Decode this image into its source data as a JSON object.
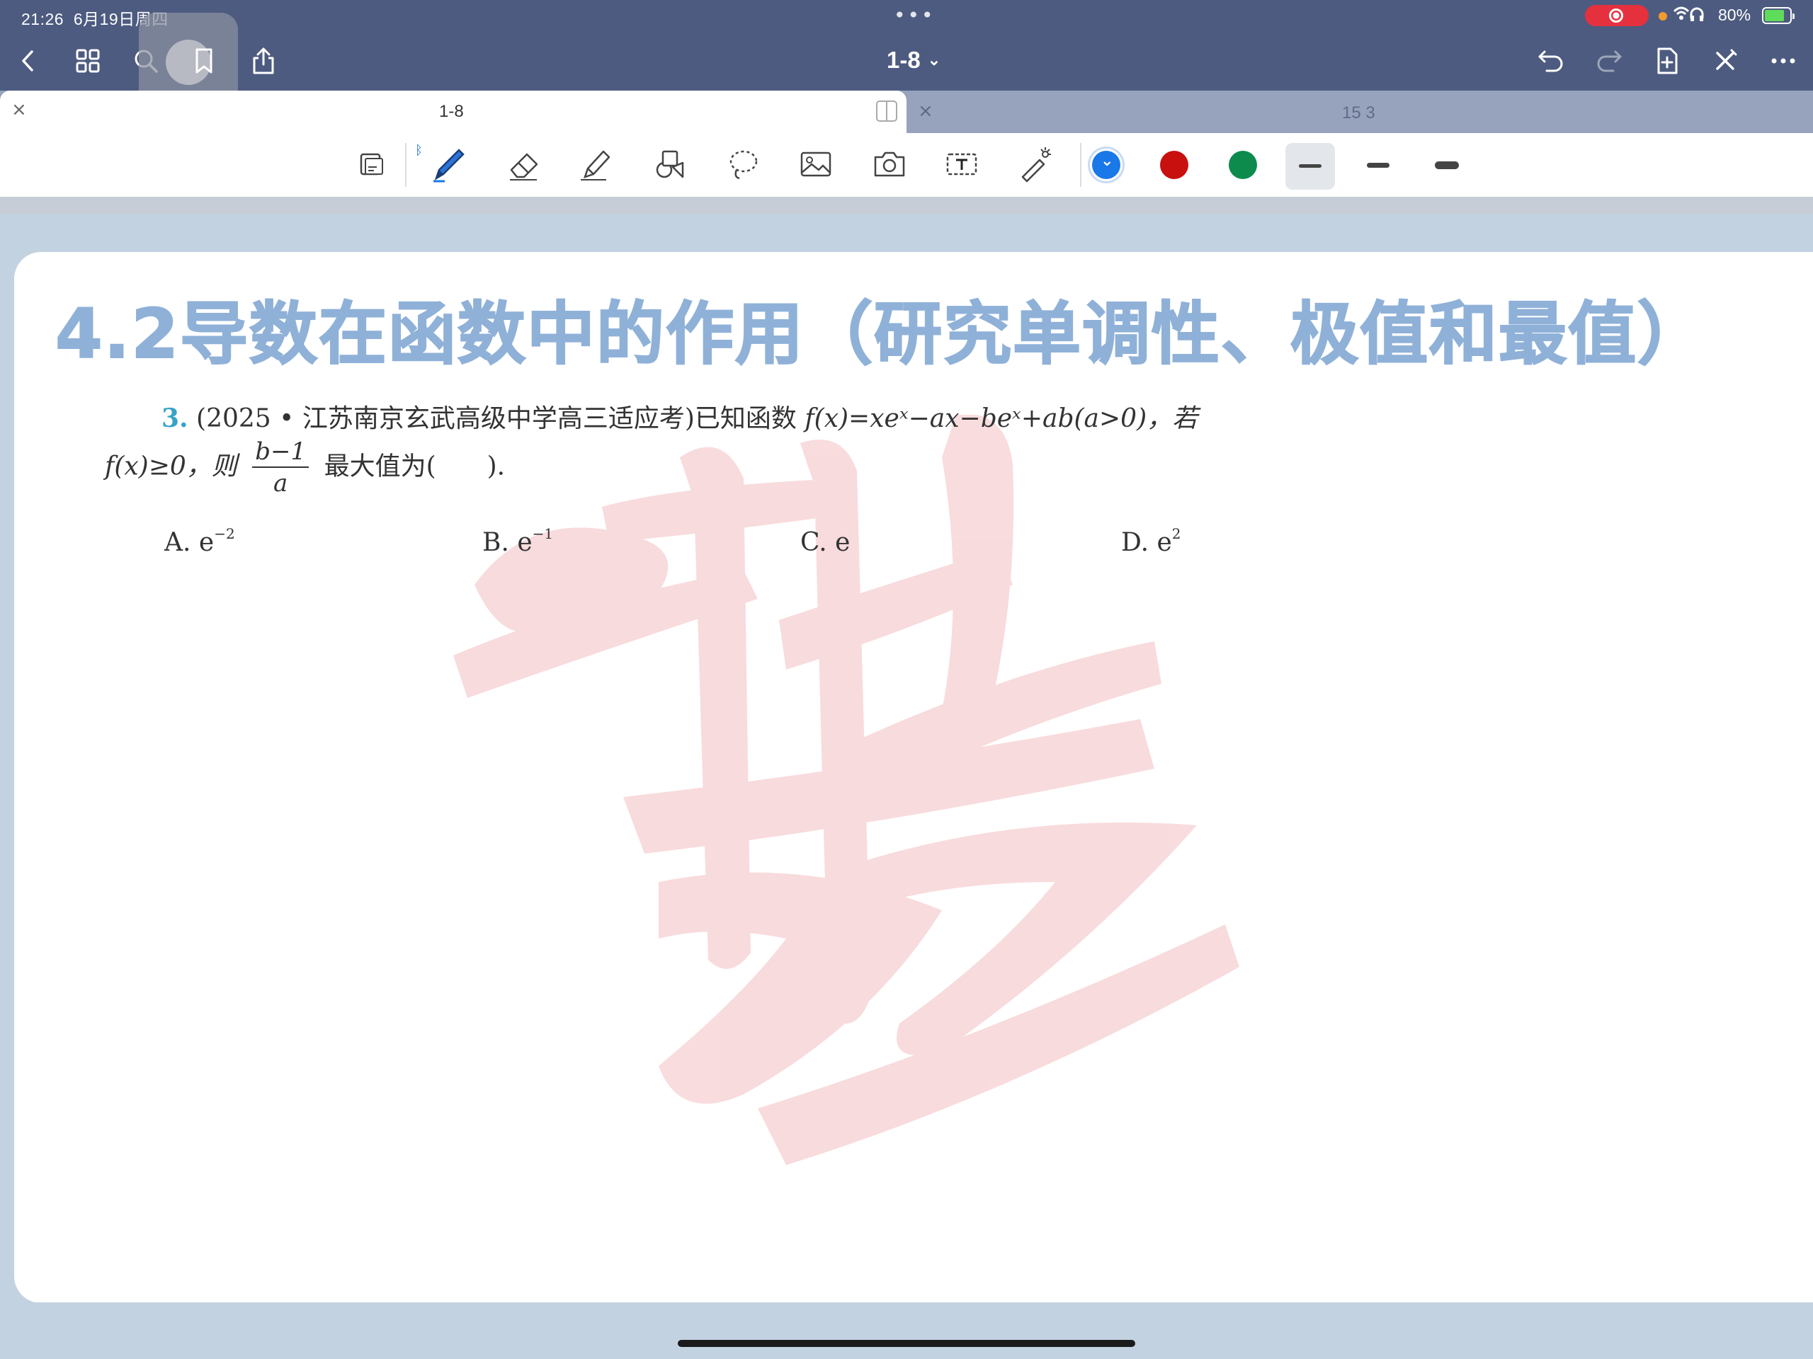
{
  "status_bar": {
    "time": "21:26",
    "date": "6月19日周四",
    "battery": "80%"
  },
  "nav": {
    "title": "1-8"
  },
  "tabs": [
    {
      "label": "1-8",
      "active": true
    },
    {
      "label": "15 3",
      "active": false
    }
  ],
  "toolbar": {
    "tools": [
      "page-transform-icon",
      "pen-icon",
      "eraser-icon",
      "highlighter-icon",
      "shapes-icon",
      "lasso-icon",
      "image-icon",
      "camera-icon",
      "text-icon",
      "laser-pointer-icon"
    ],
    "colors": [
      "#1a78e8",
      "#c8100f",
      "#0c8b4d"
    ]
  },
  "document": {
    "heading": "4.2导数在函数中的作用（研究单调性、极值和最值）",
    "question": {
      "number": "3.",
      "source": "(2025 • 江苏南京玄武高级中学高三适应考)已知函数",
      "function": "f(x)=xeˣ−ax−beˣ+ab(a>0)，若",
      "condition": "f(x)≥0，则",
      "frac_num": "b−1",
      "frac_den": "a",
      "suffix": "最大值为(　　)."
    },
    "choices": [
      {
        "letter": "A.",
        "base": "e",
        "exp": "−2"
      },
      {
        "letter": "B.",
        "base": "e",
        "exp": "−1"
      },
      {
        "letter": "C.",
        "base": "e",
        "exp": ""
      },
      {
        "letter": "D.",
        "base": "e",
        "exp": "2"
      }
    ]
  }
}
